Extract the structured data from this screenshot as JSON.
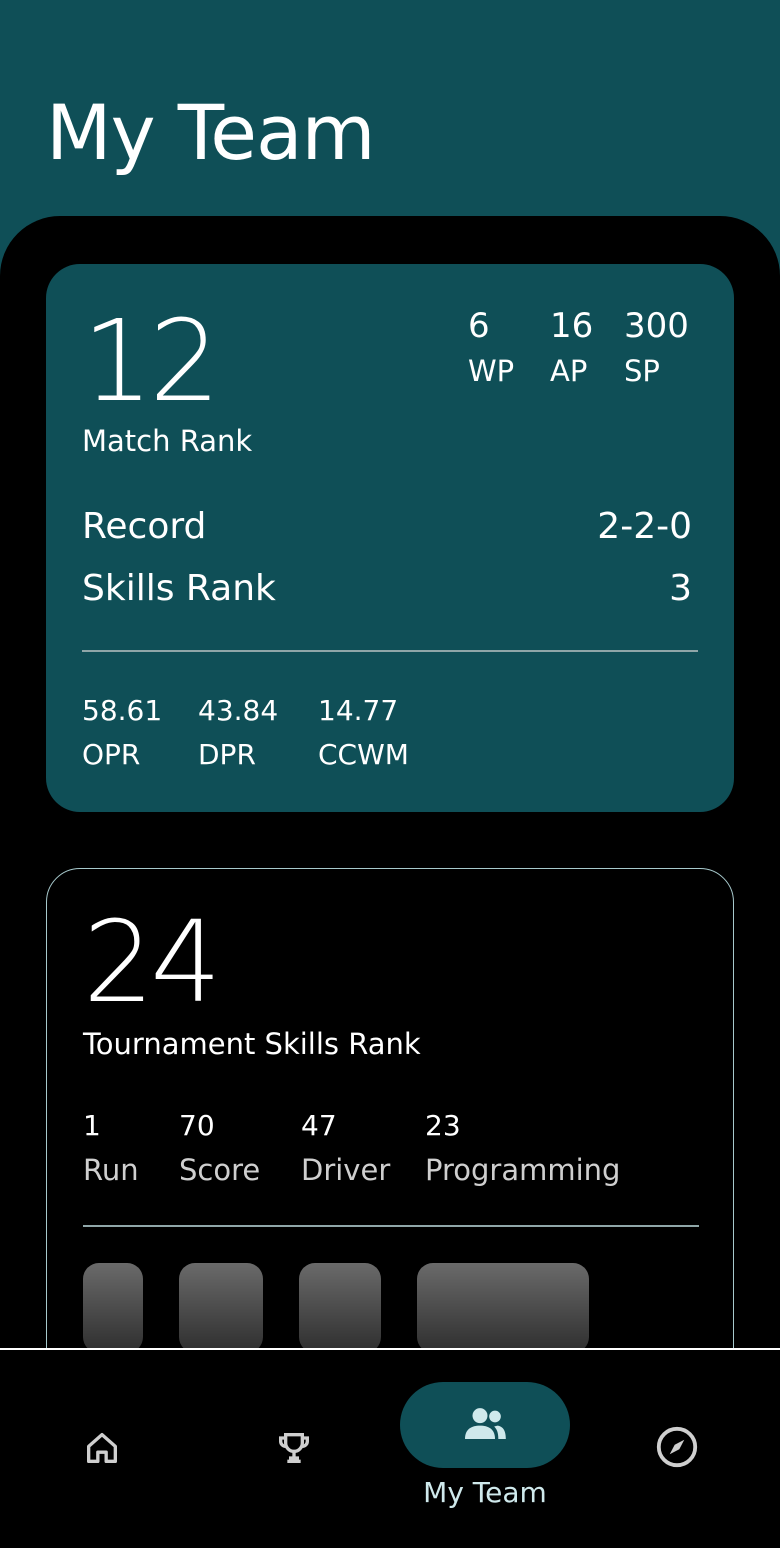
{
  "page": {
    "title": "My Team"
  },
  "match_card": {
    "rank": "12",
    "rank_label": "Match Rank",
    "stats": [
      {
        "value": "6",
        "label": "WP"
      },
      {
        "value": "16",
        "label": "AP"
      },
      {
        "value": "300",
        "label": "SP"
      }
    ],
    "record_label": "Record",
    "record_value": "2-2-0",
    "skills_rank_label": "Skills Rank",
    "skills_rank_value": "3",
    "metrics": [
      {
        "value": "58.61",
        "label": "OPR"
      },
      {
        "value": "43.84",
        "label": "DPR"
      },
      {
        "value": "14.77",
        "label": "CCWM"
      }
    ]
  },
  "skills_card": {
    "rank": "24",
    "rank_label": "Tournament Skills Rank",
    "stats": [
      {
        "value": "1",
        "label": "Run"
      },
      {
        "value": "70",
        "label": "Score"
      },
      {
        "value": "47",
        "label": "Driver"
      },
      {
        "value": "23",
        "label": "Programming"
      }
    ]
  },
  "nav": {
    "items": [
      {
        "icon": "home-icon"
      },
      {
        "icon": "trophy-icon"
      },
      {
        "icon": "team-icon",
        "label": "My Team",
        "active": true
      },
      {
        "icon": "compass-icon"
      }
    ]
  },
  "colors": {
    "accent": "#0f4f57",
    "background": "#000000",
    "text": "#ffffff"
  }
}
